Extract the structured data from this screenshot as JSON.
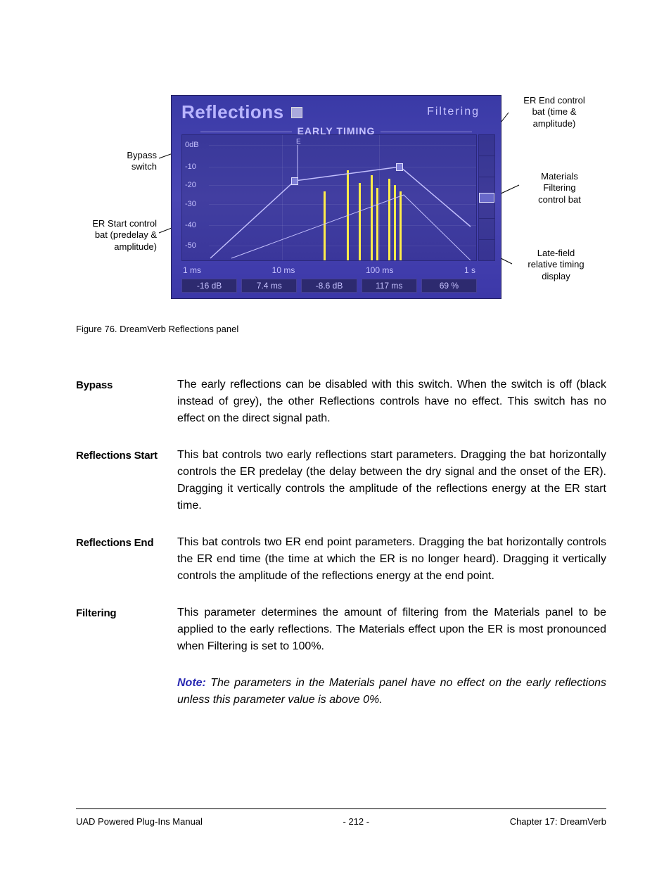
{
  "diagram": {
    "panel_title": "Reflections",
    "filtering_label": "Filtering",
    "early_timing": "EARLY TIMING",
    "y_ticks": [
      "0dB",
      "-10",
      "-20",
      "-30",
      "-40",
      "-50"
    ],
    "x_ticks": [
      "1 ms",
      "10 ms",
      "100 ms",
      "1 s"
    ],
    "readouts": [
      "-16 dB",
      "7.4 ms",
      "-8.6 dB",
      "117 ms",
      "69 %"
    ],
    "e_marker": "E"
  },
  "annotations": {
    "bypass": "Bypass\nswitch",
    "er_start": "ER Start control\nbat (predelay &\namplitude)",
    "er_end": "ER End control\nbat (time &\namplitude)",
    "materials": "Materials\nFiltering\ncontrol bat",
    "late_field": "Late-field\nrelative timing\ndisplay"
  },
  "figure_caption": "Figure 76.  DreamVerb Reflections panel",
  "defs": {
    "bypass": {
      "term": "Bypass",
      "body": "The early reflections can be disabled with this switch. When the switch is off (black instead of grey), the other Reflections controls have no effect. This switch has no effect on the direct signal path."
    },
    "reflections_start": {
      "term": "Reflections Start",
      "body": "This bat controls two early reflections start parameters. Dragging the bat horizontally controls the ER predelay (the delay between the dry signal and the onset of the ER). Dragging it vertically controls the amplitude of the reflections energy at the ER start time."
    },
    "reflections_end": {
      "term": "Reflections End",
      "body": "This bat controls two ER end point parameters. Dragging the bat horizontally controls the ER end time (the time at which the ER is no longer heard). Dragging it vertically controls the amplitude of the reflections energy at the end point."
    },
    "filtering": {
      "term": "Filtering",
      "body": "This parameter determines the amount of filtering from the Materials panel to be applied to the early reflections. The Materials effect upon the ER is most pronounced when Filtering is set to 100%."
    },
    "note": {
      "label": "Note:",
      "body": " The parameters in the Materials panel have no effect on the early reflections unless this parameter value is above 0%."
    }
  },
  "footer": {
    "left": "UAD Powered Plug-Ins Manual",
    "center": "- 212 -",
    "right": "Chapter 17: DreamVerb"
  }
}
